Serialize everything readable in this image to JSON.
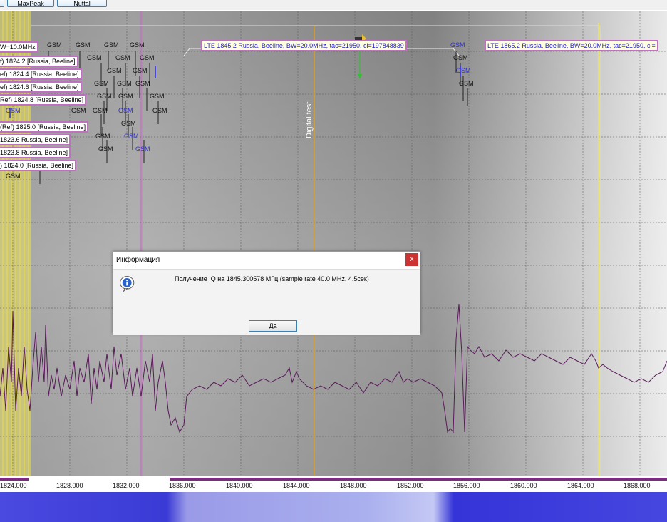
{
  "toolbar": {
    "buttons": [
      "MaxPeak",
      "Nuttal"
    ]
  },
  "labels_left": [
    "W=10.0MHz",
    "f) 1824.2 [Russia, Beeline]",
    "ef) 1824.4 [Russia, Beeline]",
    "ef) 1824.6 [Russia, Beeline]",
    "Ref) 1824.8 [Russia, Beeline]",
    "(Ref) 1825.0 [Russia, Beeline]",
    "1823.6 Russia, Beeline]",
    "1823.8 Russia, Beeline]",
    ") 1824.0 [Russia, Beeline]"
  ],
  "lte_labels": [
    "LTE 1845.2 Russia, Beeline, BW=20.0MHz, tac=21950, ci=197848839",
    "LTE 1865.2 Russia, Beeline, BW=20.0MHz, tac=21950, ci="
  ],
  "gsm_text": "GSM",
  "digital_test": "Digital test",
  "x_ticks": [
    "1824.000",
    "1828.000",
    "1832.000",
    "1836.000",
    "1840.000",
    "1844.000",
    "1848.000",
    "1852.000",
    "1856.000",
    "1860.000",
    "1864.000",
    "1868.000"
  ],
  "dialog": {
    "title": "Информация",
    "close": "x",
    "message": "Получение IQ на 1845.300578 МГц (sample rate 40.0 MHz, 4.5сек)",
    "ok": "Да"
  },
  "colors": {
    "lte_text": "#2020c0",
    "label_border": "#c070c0",
    "trace": "#5a1a5a",
    "marker": "#e0a020"
  }
}
